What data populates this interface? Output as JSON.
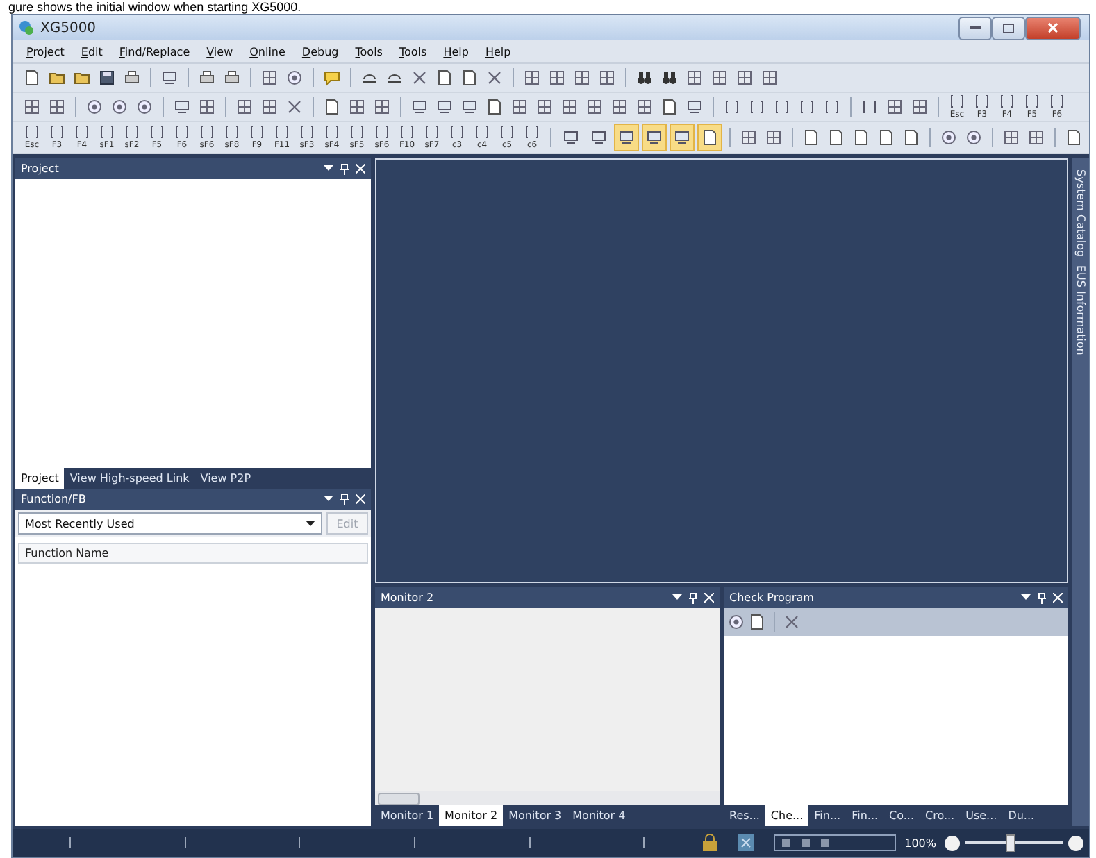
{
  "caption": "gure shows the initial window when starting XG5000.",
  "window": {
    "title": "XG5000"
  },
  "menu": [
    {
      "label": "Project"
    },
    {
      "label": "Edit"
    },
    {
      "label": "Find/Replace"
    },
    {
      "label": "View"
    },
    {
      "label": "Online"
    },
    {
      "label": "Debug"
    },
    {
      "label": "Tools"
    },
    {
      "label": "Tools"
    },
    {
      "label": "Help"
    },
    {
      "label": "Help"
    }
  ],
  "toolbar_2_keys": [
    "Esc",
    "F3",
    "F4",
    "F5",
    "F6"
  ],
  "toolbar_3_keys": [
    "Esc",
    "F3",
    "F4",
    "sF1",
    "sF2",
    "F5",
    "F6",
    "sF6",
    "sF8",
    "F9",
    "F11",
    "sF3",
    "sF4",
    "sF5",
    "sF6",
    "F10",
    "sF7",
    "c3",
    "c4",
    "c5",
    "c6"
  ],
  "view_toggles": [
    {
      "selected": false
    },
    {
      "selected": false
    },
    {
      "selected": true
    },
    {
      "selected": true
    },
    {
      "selected": true
    },
    {
      "selected": true
    }
  ],
  "project_panel": {
    "title": "Project",
    "tabs": [
      {
        "label": "Project",
        "selected": true
      },
      {
        "label": "View High-speed Link",
        "selected": false
      },
      {
        "label": "View P2P",
        "selected": false
      }
    ]
  },
  "function_panel": {
    "title": "Function/FB",
    "filter": "Most Recently Used",
    "edit_button": {
      "label": "Edit",
      "disabled": true
    },
    "column": "Function Name"
  },
  "side_tabs": [
    {
      "label": "System Catalog"
    },
    {
      "label": "EUS Information"
    }
  ],
  "monitor_panel": {
    "title": "Monitor 2",
    "tabs": [
      {
        "label": "Monitor 1",
        "selected": false
      },
      {
        "label": "Monitor 2",
        "selected": true
      },
      {
        "label": "Monitor 3",
        "selected": false
      },
      {
        "label": "Monitor 4",
        "selected": false
      }
    ]
  },
  "check_panel": {
    "title": "Check Program",
    "tabs": [
      {
        "label": "Res...",
        "selected": false
      },
      {
        "label": "Che...",
        "selected": true
      },
      {
        "label": "Fin...",
        "selected": false
      },
      {
        "label": "Fin...",
        "selected": false
      },
      {
        "label": "Co...",
        "selected": false
      },
      {
        "label": "Cro...",
        "selected": false
      },
      {
        "label": "Use...",
        "selected": false
      },
      {
        "label": "Du...",
        "selected": false
      }
    ]
  },
  "status_bar": {
    "zoom": "100%",
    "zoom_slider": {
      "level": 0.45
    }
  }
}
